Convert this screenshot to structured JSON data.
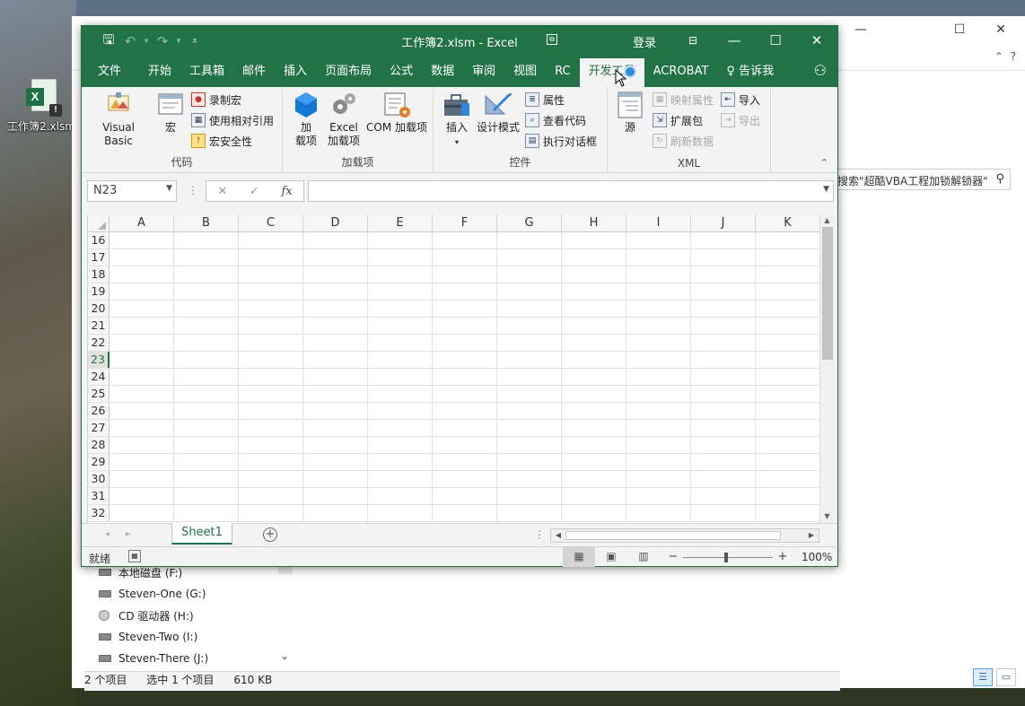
{
  "desktop": {
    "icon_label": "工作簿2.xlsm"
  },
  "explorer": {
    "search_placeholder": "搜索\"超酷VBA工程加锁解锁器\"",
    "drives": [
      {
        "label": "本地磁盘 (F:)"
      },
      {
        "label": "Steven-One (G:)"
      },
      {
        "label": "CD 驱动器 (H:)"
      },
      {
        "label": "Steven-Two (I:)"
      },
      {
        "label": "Steven-There (J:)"
      }
    ],
    "status": {
      "items_count": "2 个项目",
      "selected": "选中 1 个项目",
      "size": "610 KB"
    }
  },
  "excel": {
    "title": "工作簿2.xlsm  -  Excel",
    "login": "登录",
    "tabs": [
      {
        "label": "文件"
      },
      {
        "label": "开始"
      },
      {
        "label": "工具箱"
      },
      {
        "label": "邮件"
      },
      {
        "label": "插入"
      },
      {
        "label": "页面布局"
      },
      {
        "label": "公式"
      },
      {
        "label": "数据"
      },
      {
        "label": "审阅"
      },
      {
        "label": "视图"
      },
      {
        "label": "RC"
      },
      {
        "label": "开发工具"
      },
      {
        "label": "ACROBAT"
      },
      {
        "label": "告诉我"
      }
    ],
    "active_tab": "开发工具",
    "ribbon": {
      "code_group": {
        "label": "代码",
        "visual_basic": "Visual Basic",
        "macros": "宏",
        "record_macro": "录制宏",
        "relative_refs": "使用相对引用",
        "macro_security": "宏安全性"
      },
      "addins_group": {
        "label": "加载项",
        "addins": "加\n载项",
        "addins_line1": "加",
        "addins_line2": "载项",
        "excel_addins_line1": "Excel",
        "excel_addins_line2": "加载项",
        "com_addins": "COM 加载项"
      },
      "controls_group": {
        "label": "控件",
        "insert": "插入",
        "design_mode": "设计模式",
        "properties": "属性",
        "view_code": "查看代码",
        "run_dialog": "执行对话框"
      },
      "xml_group": {
        "label": "XML",
        "source": "源",
        "map_properties": "映射属性",
        "expansion_packs": "扩展包",
        "refresh_data": "刷新数据",
        "import": "导入",
        "export": "导出"
      }
    },
    "name_box": "N23",
    "formula": "",
    "columns": [
      "A",
      "B",
      "C",
      "D",
      "E",
      "F",
      "G",
      "H",
      "I",
      "J",
      "K"
    ],
    "rows": [
      "16",
      "17",
      "18",
      "19",
      "20",
      "21",
      "22",
      "23",
      "24",
      "25",
      "26",
      "27",
      "28",
      "29",
      "30",
      "31",
      "32"
    ],
    "selected_row": "23",
    "sheet_tab": "Sheet1",
    "status_ready": "就绪",
    "zoom": "100%"
  }
}
